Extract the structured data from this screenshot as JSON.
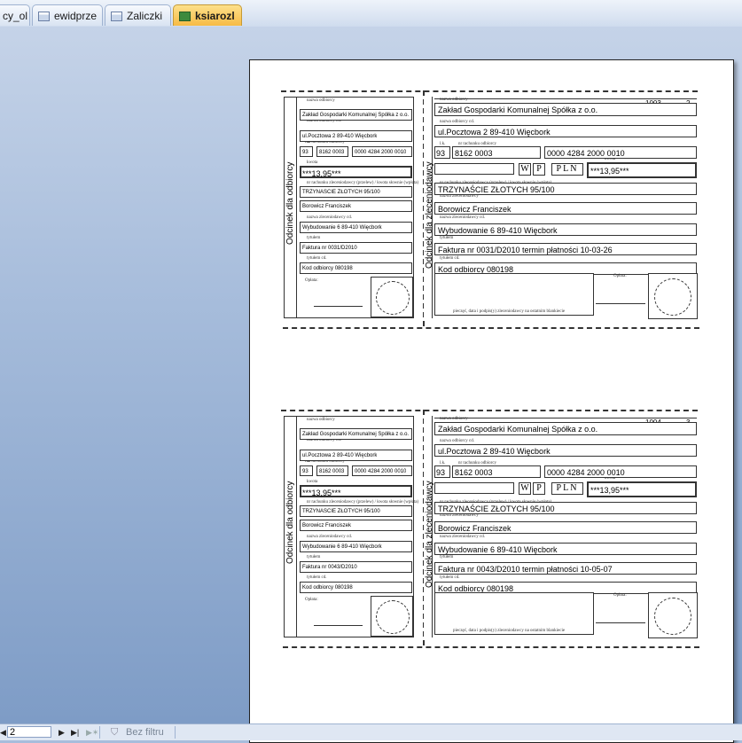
{
  "tabs": [
    {
      "label": "cy_ol",
      "active": false
    },
    {
      "label": "ewidprze",
      "active": false
    },
    {
      "label": "Zaliczki",
      "active": false
    },
    {
      "label": "ksiarozl",
      "active": true
    }
  ],
  "form_labels": {
    "odbiorca_title": "Odcinek dla odbiorcy",
    "zleceniodawca_title": "Odcinek dla zleceniodawcy",
    "nazwa_odbiorcy": "nazwa odbiorcy",
    "nazwa_odbiorcy_cd": "nazwa odbiorcy cd.",
    "lk": "l.k.",
    "rachunek_odbiorcy": "nr rachunku odbiorcy",
    "kwota": "kwota",
    "waluta": "waluta",
    "slownie": "nr rachunku zleceniodawcy (przelew) / kwota słownie (wpłata)",
    "nazwa_zleceniodawcy": "nazwa zleceniodawcy",
    "nazwa_zleceniodawcy_cd": "nazwa zleceniodawcy cd.",
    "tytulem": "tytułem",
    "tytulem_cd": "tytułem cd.",
    "oplata": "Opłata:",
    "podpis": "pieczęć, data i podpis(y) zleceniodawcy na ostatnim blankiecie",
    "w": "W",
    "p": "P",
    "pln": "PLN"
  },
  "slips": [
    {
      "number": "1003",
      "copy": "2",
      "recipient_name": "Zakład Gospodarki Komunalnej Spółka z o.o.",
      "recipient_address": "ul.Pocztowa 2 89-410 Więcbork",
      "lk": "93",
      "account_part1": "8162 0003",
      "account_part2": "0000 4284 2000 0010",
      "amount": "***13,95***",
      "amount_words": "TRZYNAŚCIE ZŁOTYCH  95/100",
      "payer_name": "Borowicz Franciszek",
      "payer_address": "Wybudowanie 6 89-410 Więcbork",
      "title": "Faktura nr 0031/D2010",
      "title_full": "Faktura nr 0031/D2010  termin płatności 10-03-26",
      "title_cd": "Kod odbiorcy 080198"
    },
    {
      "number": "1004",
      "copy": "3",
      "recipient_name": "Zakład Gospodarki Komunalnej Spółka z o.o.",
      "recipient_address": "ul.Pocztowa 2 89-410 Więcbork",
      "lk": "93",
      "account_part1": "8162 0003",
      "account_part2": "0000 4284 2000 0010",
      "amount": "***13,95***",
      "amount_words": "TRZYNAŚCIE ZŁOTYCH  95/100",
      "payer_name": "Borowicz Franciszek",
      "payer_address": "Wybudowanie 6 89-410 Więcbork",
      "title": "Faktura nr 0043/D2010",
      "title_full": "Faktura nr 0043/D2010  termin płatności 10-05-07",
      "title_cd": "Kod odbiorcy 080198"
    }
  ],
  "statusbar": {
    "page_value": "2",
    "filter_label": "Bez filtru"
  },
  "icons": [
    "first-page-icon",
    "next-page-icon",
    "last-page-icon",
    "new-record-icon",
    "filter-icon",
    "report-icon",
    "table-icon"
  ]
}
